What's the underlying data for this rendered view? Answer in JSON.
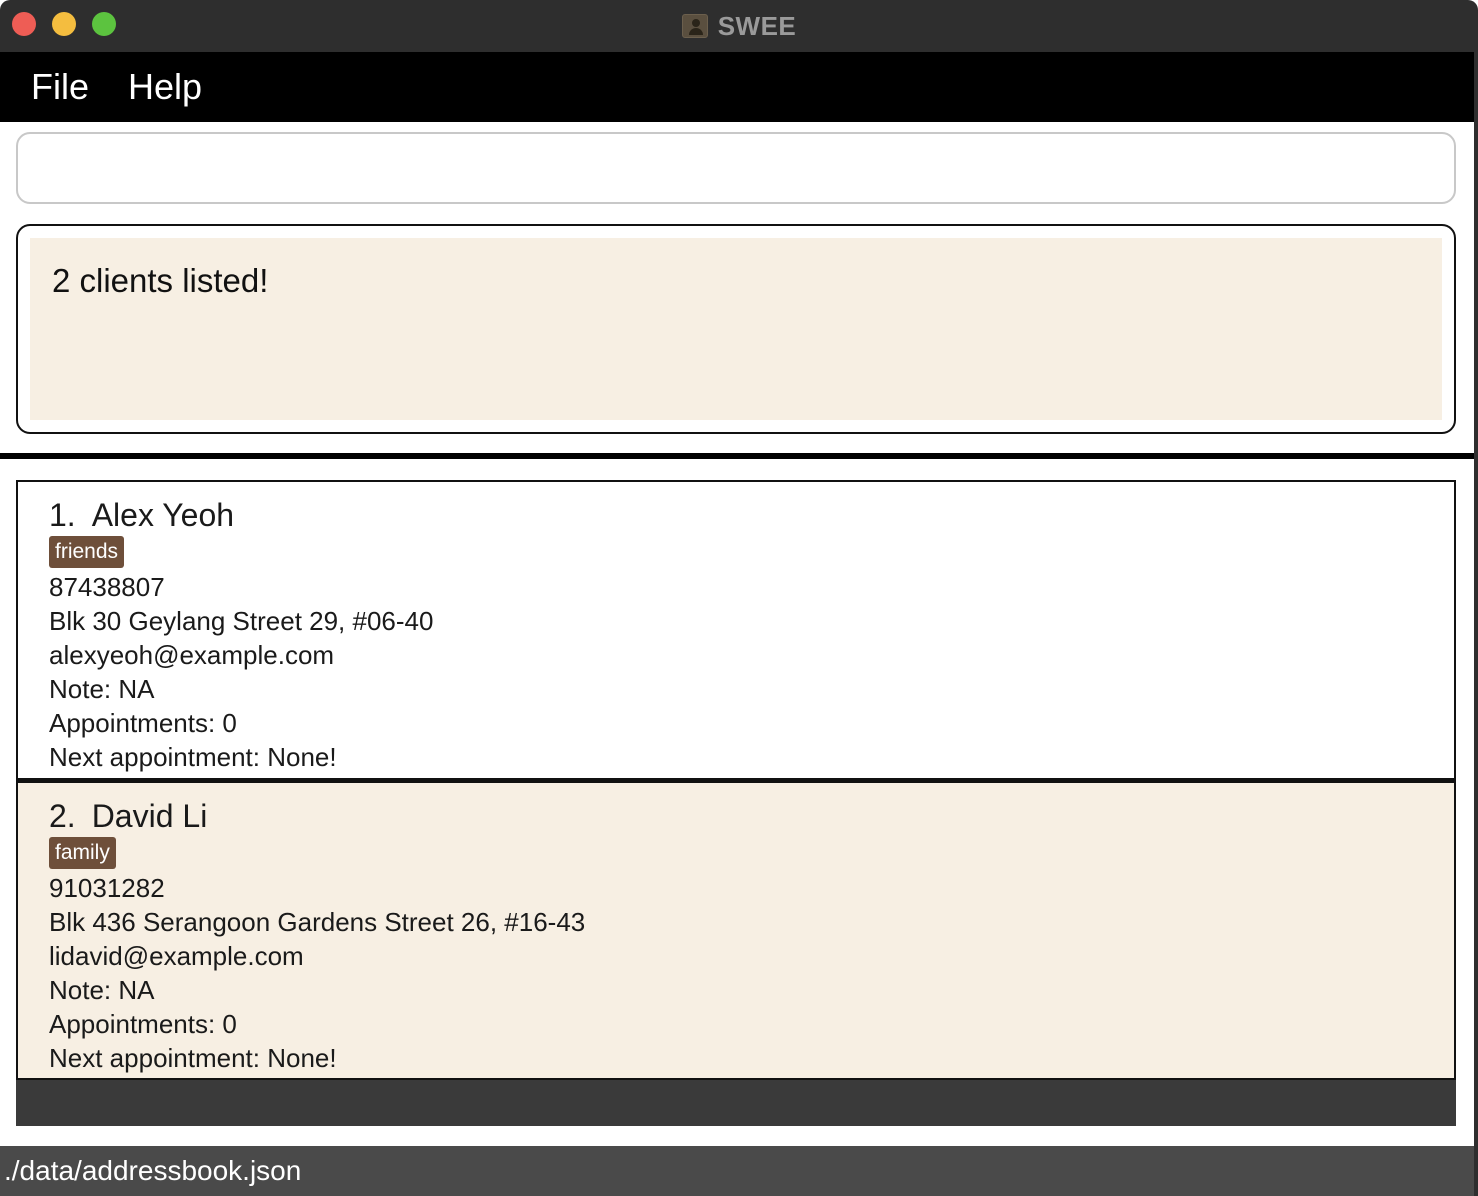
{
  "window": {
    "title": "SWEE"
  },
  "menu": {
    "file_label": "File",
    "help_label": "Help"
  },
  "command_box": {
    "value": "",
    "placeholder": ""
  },
  "result": {
    "message": "2 clients listed!"
  },
  "clients": [
    {
      "index": "1.",
      "name": "Alex Yeoh",
      "tag": "friends",
      "phone": "87438807",
      "address": "Blk 30 Geylang Street 29, #06-40",
      "email": "alexyeoh@example.com",
      "note": "Note: NA",
      "appointments": "Appointments: 0",
      "next_appointment": "Next appointment: None!"
    },
    {
      "index": "2.",
      "name": "David Li",
      "tag": "family",
      "phone": "91031282",
      "address": "Blk 436 Serangoon Gardens Street 26, #16-43",
      "email": "lidavid@example.com",
      "note": "Note: NA",
      "appointments": "Appointments: 0",
      "next_appointment": "Next appointment: None!"
    }
  ],
  "status_bar": {
    "path": "./data/addressbook.json"
  },
  "colors": {
    "titlebar": "#2e2e2e",
    "menubar": "#000000",
    "result_bg": "#f7efe3",
    "tag_bg": "#6e4f3a",
    "selected_card_bg": "#f7efe3",
    "statusbar": "#4a4a4a"
  }
}
